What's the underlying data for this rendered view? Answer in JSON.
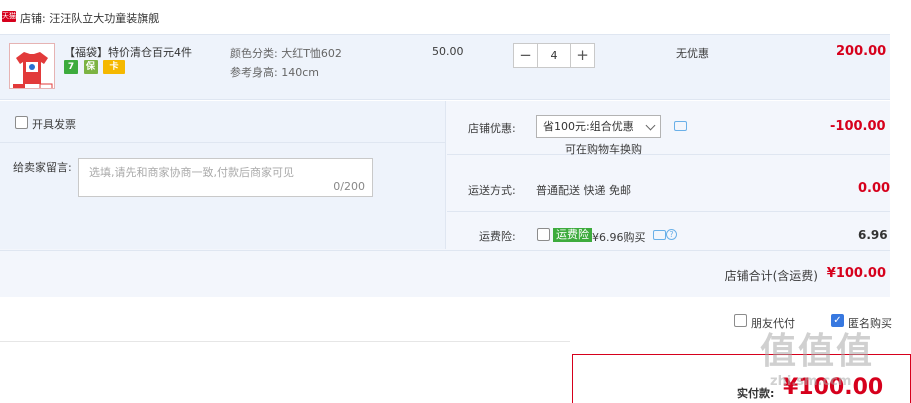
{
  "shop": {
    "tmall_badge": "天猫",
    "label": "店铺:",
    "name": "汪汪队立大功童装旗舰"
  },
  "item": {
    "title": "【福袋】特价清仓百元4件",
    "badges": [
      "7",
      "保",
      "卡"
    ],
    "sku_color": "颜色分类: 大红T恤602",
    "sku_height": "参考身高: 140cm",
    "unit_price": "50.00",
    "qty_minus": "−",
    "quantity": "4",
    "qty_plus": "+",
    "promo": "无优惠",
    "subtotal": "200.00"
  },
  "options": {
    "invoice_label": "开具发票",
    "message_label": "给卖家留言:",
    "message_placeholder": "选填,请先和商家协商一致,付款后商家可见",
    "message_count": "0/200",
    "shop_discount_label": "店铺优惠:",
    "shop_discount_value": "省100元:组合优惠",
    "shop_discount_hint": "可在购物车换购",
    "shop_discount_amount": "-100.00",
    "shipping_label": "运送方式:",
    "shipping_value": "普通配送 快递 免邮",
    "shipping_amount": "0.00",
    "insurance_label": "运费险:",
    "insurance_tag": "运费险",
    "insurance_price": "¥6.96购买",
    "insurance_amount": "6.96",
    "shop_total_label": "店铺合计(含运费)",
    "shop_total_value": "¥100.00"
  },
  "footer": {
    "friend_pay_label": "朋友代付",
    "anonymous_label": "匿名购买",
    "pay_label": "实付款:",
    "pay_value": "¥100.00",
    "watermark": "值值值",
    "watermark_sub": "zhi.sm.ccm"
  },
  "colors": {
    "accent": "#d6001c",
    "panel": "#eef3fb",
    "check": "#3778e0"
  }
}
